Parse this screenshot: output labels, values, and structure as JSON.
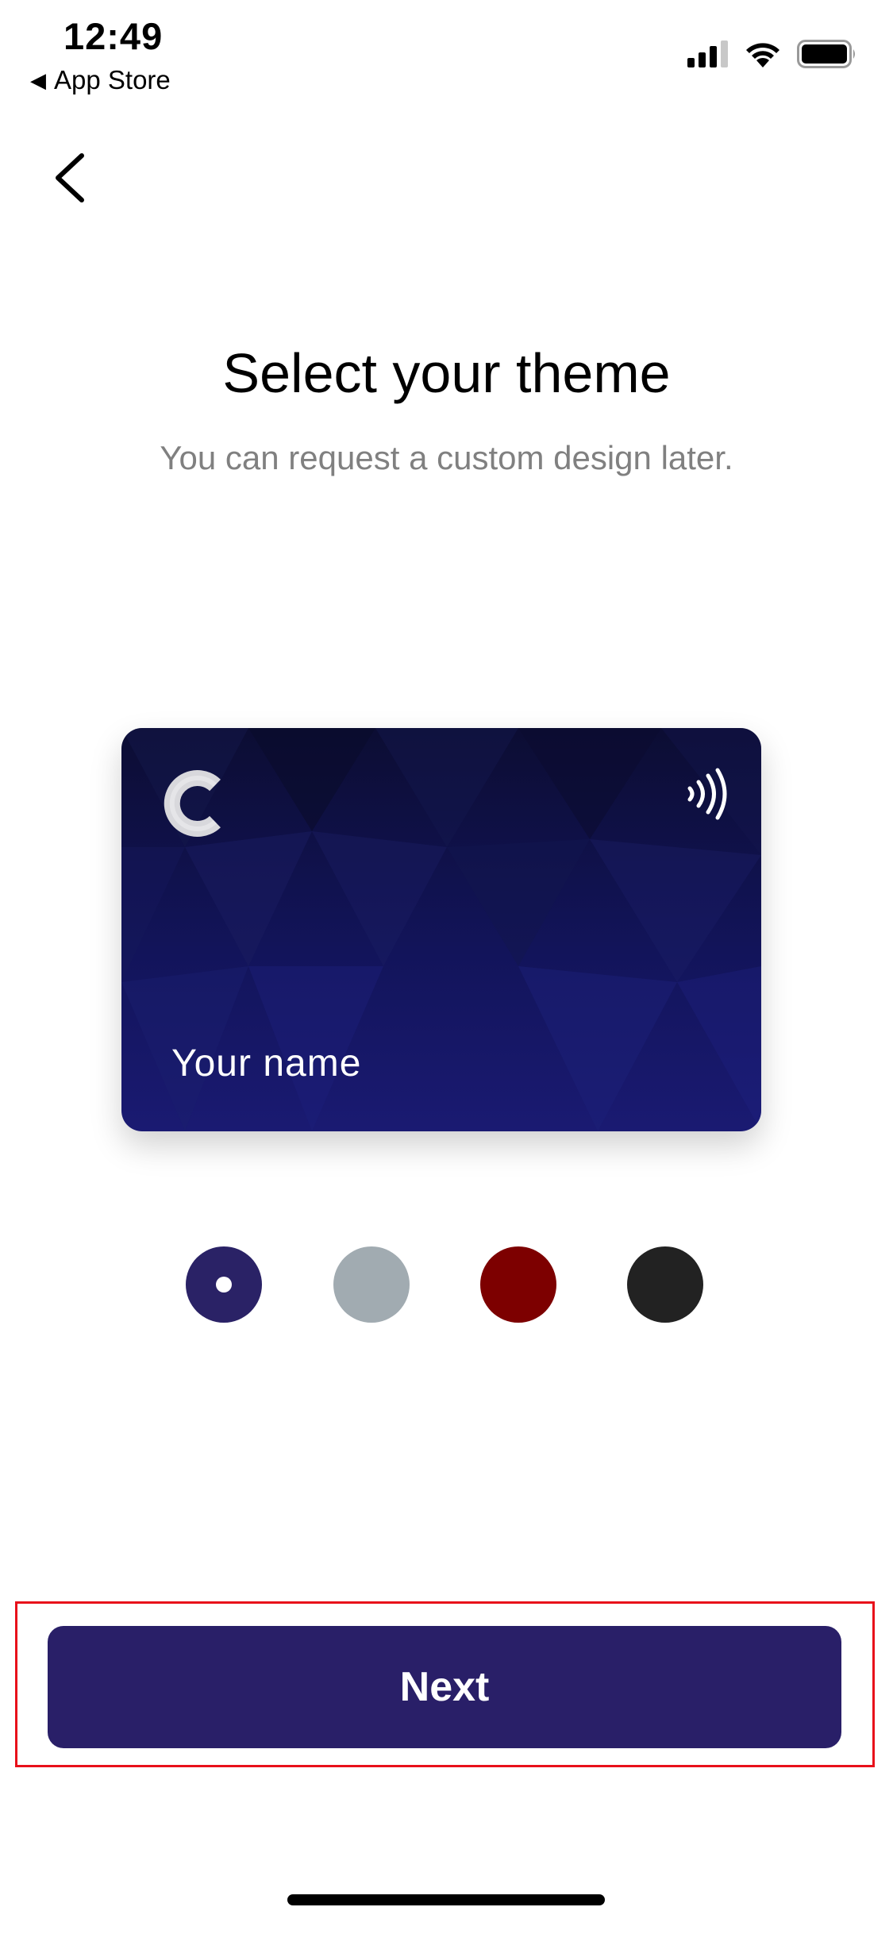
{
  "status_bar": {
    "time": "12:49",
    "back_app": "App Store",
    "signal_icon": "cellular-signal-icon",
    "wifi_icon": "wifi-icon",
    "battery_icon": "battery-icon"
  },
  "nav": {
    "back_icon": "chevron-left-icon"
  },
  "header": {
    "title": "Select your theme",
    "subtitle": "You can request a custom design later."
  },
  "card": {
    "name": "Your name",
    "logo_icon": "c-logo-icon",
    "contactless_icon": "contactless-icon"
  },
  "themes": [
    {
      "color": "#2a2266",
      "selected": true
    },
    {
      "color": "#a1abb1",
      "selected": false
    },
    {
      "color": "#7d0000",
      "selected": false
    },
    {
      "color": "#222222",
      "selected": false
    }
  ],
  "footer": {
    "next_label": "Next"
  },
  "colors": {
    "primary": "#291f68",
    "highlight": "#e8101a",
    "subtitle": "#808080"
  }
}
